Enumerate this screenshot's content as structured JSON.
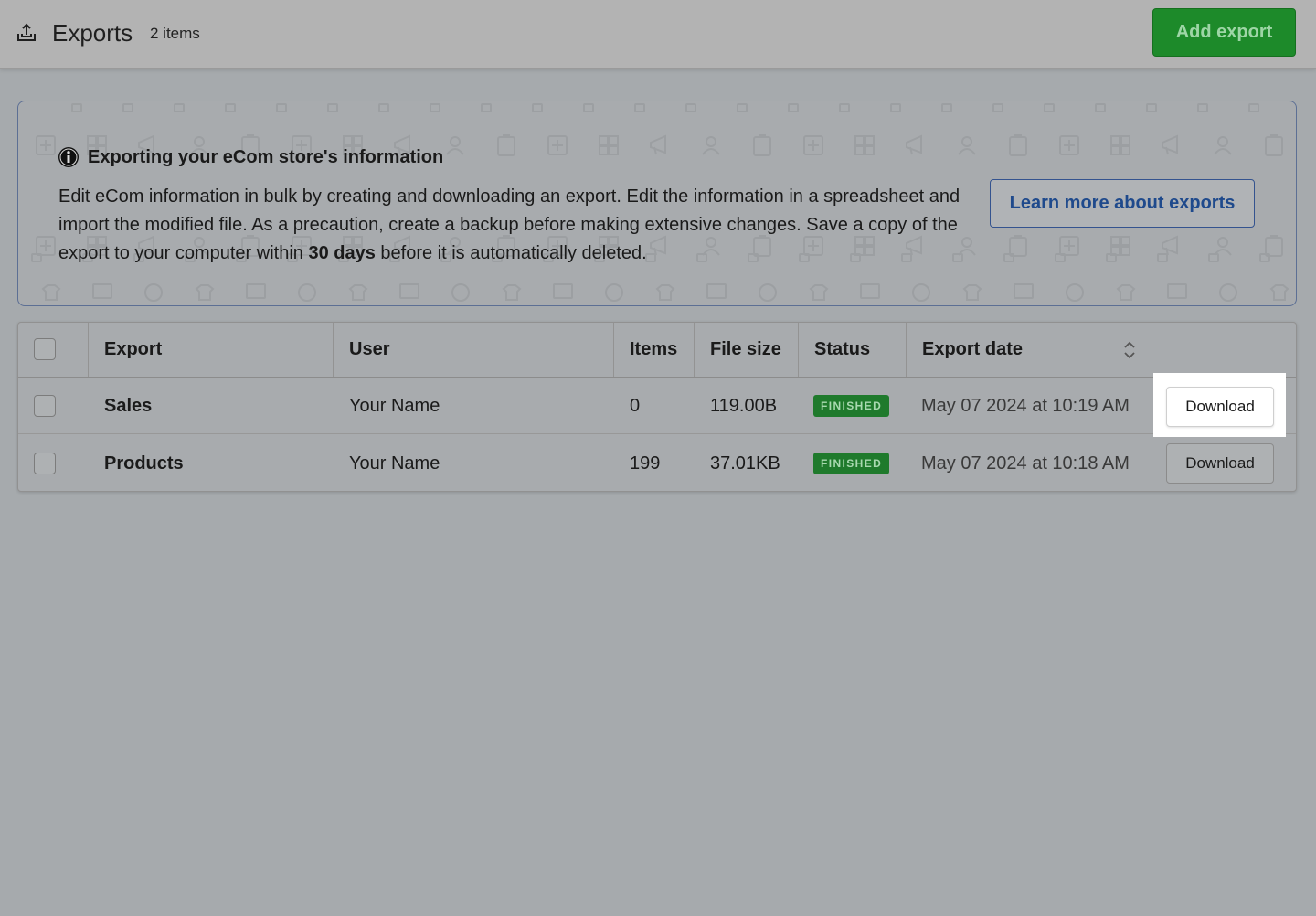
{
  "header": {
    "title": "Exports",
    "count": "2 items",
    "add_button": "Add export",
    "icon": "export-upload-icon"
  },
  "banner": {
    "title": "Exporting your eCom store's information",
    "text_before": "Edit eCom information in bulk by creating and downloading an export. Edit the information in a spreadsheet and import the modified file. As a precaution, create a backup before making extensive changes. Save a copy of the export to your computer within ",
    "text_bold": "30 days",
    "text_after": " before it is automatically deleted.",
    "learn_more": "Learn more about exports",
    "icon": "info-icon"
  },
  "table": {
    "columns": [
      "Export",
      "User",
      "Items",
      "File size",
      "Status",
      "Export date"
    ],
    "rows": [
      {
        "export": "Sales",
        "user": "Your Name",
        "items": "0",
        "file_size": "119.00B",
        "status": "FINISHED",
        "date": "May 07 2024 at 10:19 AM",
        "action": "Download"
      },
      {
        "export": "Products",
        "user": "Your Name",
        "items": "199",
        "file_size": "37.01KB",
        "status": "FINISHED",
        "date": "May 07 2024 at 10:18 AM",
        "action": "Download"
      }
    ]
  },
  "colors": {
    "accent_green": "#1d8a2a",
    "link_blue": "#1f4a8c",
    "status_green": "#1f7a2c"
  }
}
